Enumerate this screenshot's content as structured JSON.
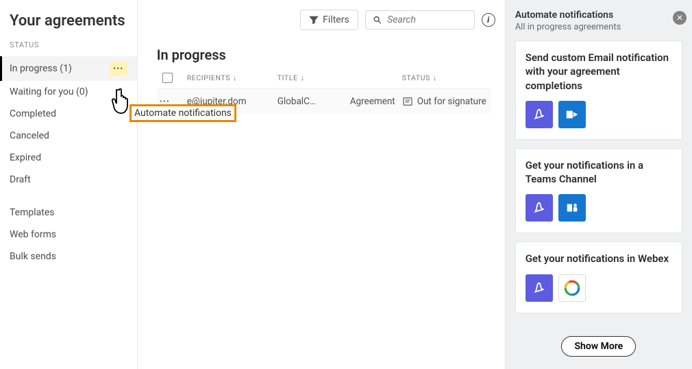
{
  "page": {
    "title": "Your agreements"
  },
  "sidebar": {
    "section_label": "STATUS",
    "items": [
      {
        "label": "In progress (1)",
        "active": true,
        "has_more": true
      },
      {
        "label": "Waiting for you (0)"
      },
      {
        "label": "Completed"
      },
      {
        "label": "Canceled"
      },
      {
        "label": "Expired"
      },
      {
        "label": "Draft"
      }
    ],
    "other": [
      {
        "label": "Templates"
      },
      {
        "label": "Web forms"
      },
      {
        "label": "Bulk sends"
      }
    ]
  },
  "topbar": {
    "filters_label": "Filters",
    "search_placeholder": "Search"
  },
  "content": {
    "title": "In progress",
    "columns": {
      "recipients": "RECIPIENTS",
      "title": "TITLE",
      "status": "STATUS"
    },
    "rows": [
      {
        "recipient": "e@jupiter.dom",
        "title": "GlobalC…",
        "type": "Agreement",
        "status": "Out for signature"
      }
    ]
  },
  "context_menu": {
    "label": "Automate notifications"
  },
  "panel": {
    "title": "Automate notifications",
    "subtitle": "All in progress agreements",
    "cards": [
      {
        "title": "Send custom Email notification with your agreement completions",
        "icons": [
          "acrobat",
          "outlook"
        ]
      },
      {
        "title": "Get your notifications in a Teams Channel",
        "icons": [
          "acrobat",
          "teams"
        ]
      },
      {
        "title": "Get your notifications in Webex",
        "icons": [
          "acrobat",
          "webex"
        ]
      }
    ],
    "show_more": "Show More"
  }
}
